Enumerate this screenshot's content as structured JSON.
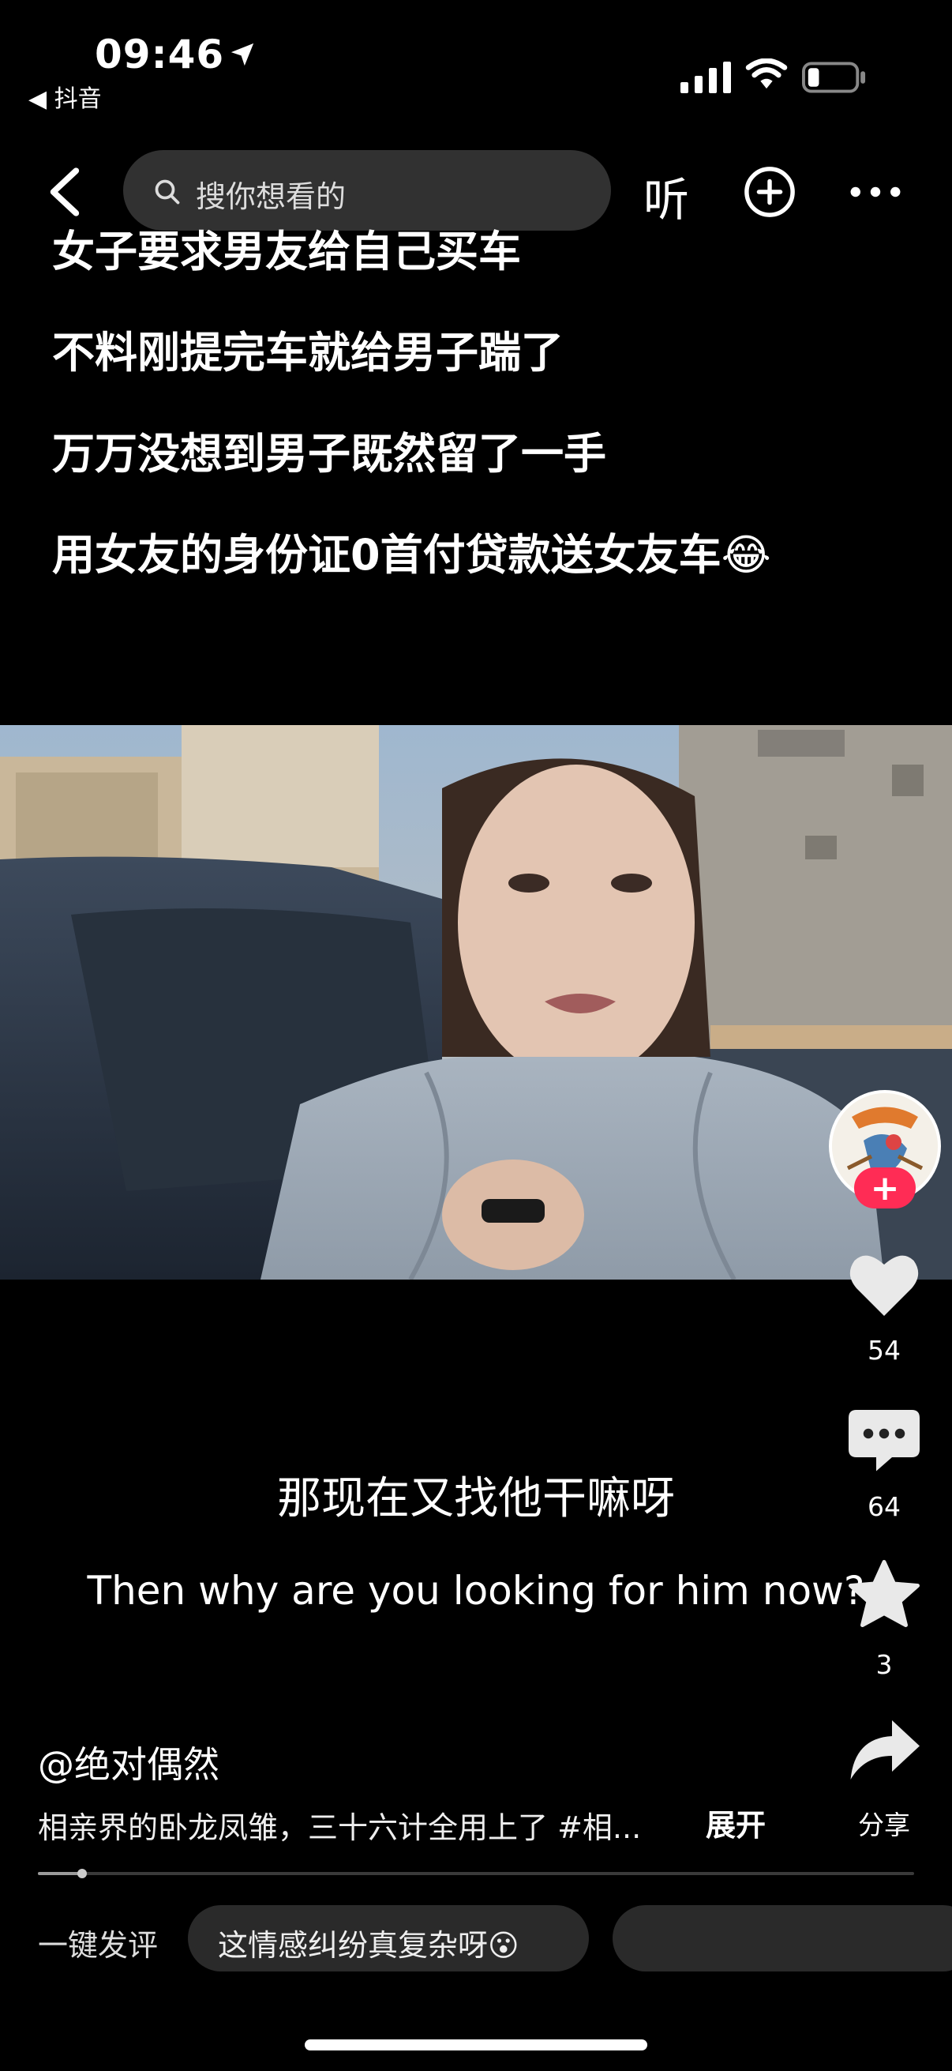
{
  "status_bar": {
    "time": "09:46",
    "back_app": "◀ 抖音"
  },
  "nav": {
    "search_placeholder": "搜你想看的",
    "listen_label": "听"
  },
  "headline": [
    "女子要求男友给自己买车",
    "不料刚提完车就给男子踹了",
    "万万没想到男子既然留了一手",
    "用女友的身份证0首付贷款送女友车😂"
  ],
  "video": {
    "subtitle_cn": "那现在又找他干嘛呀",
    "subtitle_en": "Then why are you looking for him now?"
  },
  "actions": {
    "likes": "54",
    "comments": "64",
    "favorites": "3",
    "share_label": "分享",
    "follow_symbol": "+"
  },
  "post": {
    "author": "@绝对偶然",
    "description": "相亲界的卧龙凤雏，三十六计全用上了 #相...",
    "expand_label": "展开",
    "progress": 0.05
  },
  "quick_comment": {
    "label": "一键发评",
    "chip1": "这情感纠纷真复杂呀😮"
  },
  "colors": {
    "accent": "#ff2c55",
    "background": "#000000"
  }
}
